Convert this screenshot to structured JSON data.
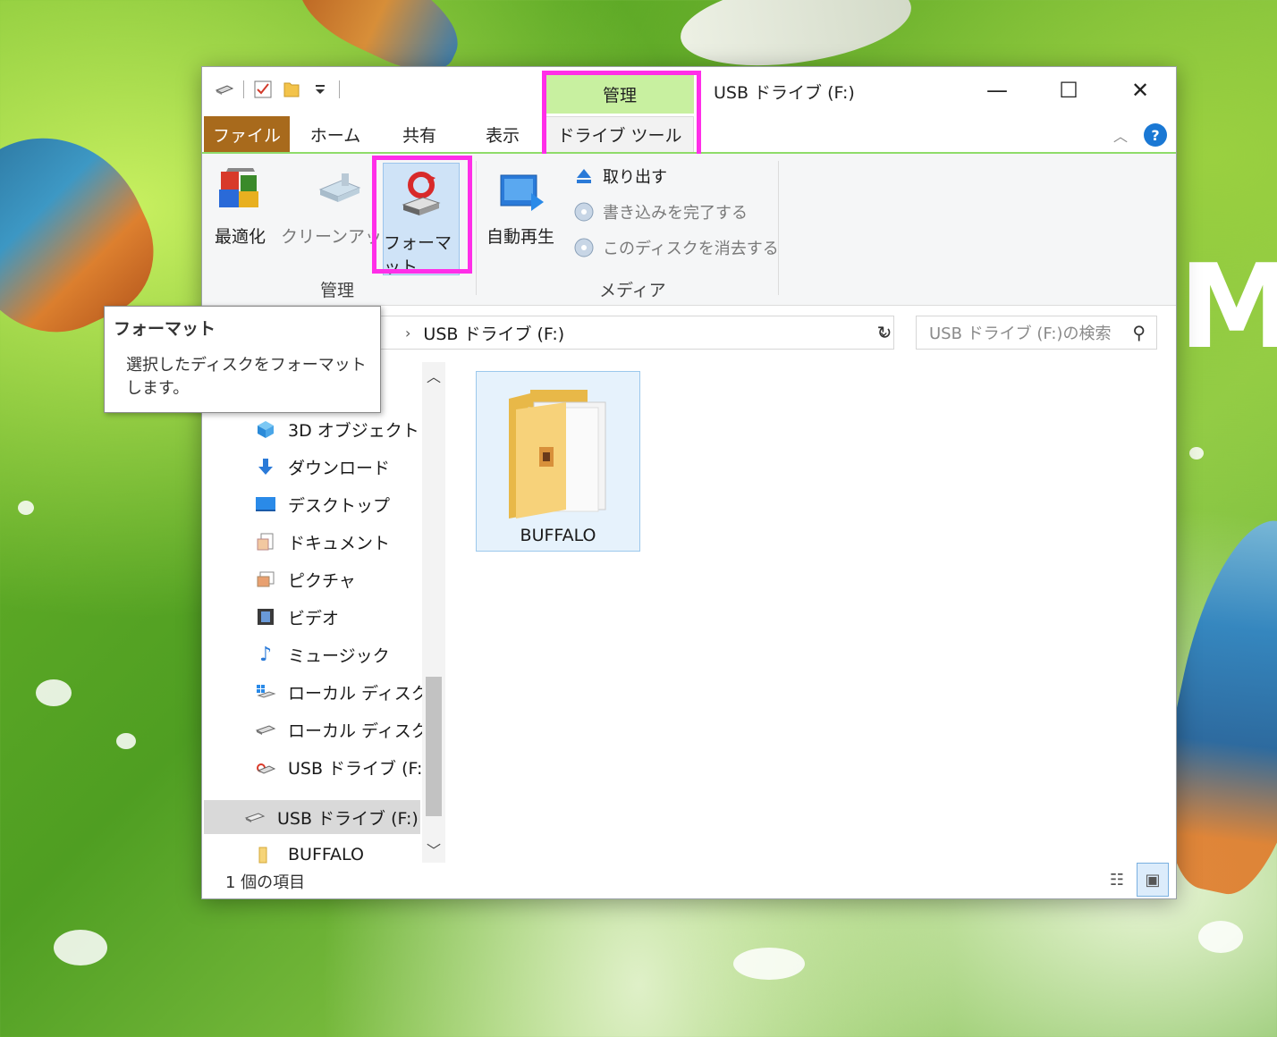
{
  "window": {
    "title": "USB ドライブ (F:)",
    "context_group": "管理",
    "controls": {
      "minimize": "—",
      "maximize": "☐",
      "close": "✕"
    }
  },
  "tabs": [
    {
      "label": "ファイル"
    },
    {
      "label": "ホーム"
    },
    {
      "label": "共有"
    },
    {
      "label": "表示"
    },
    {
      "label": "ドライブ ツール"
    }
  ],
  "ribbon": {
    "manage": {
      "label": "管理",
      "optimize": "最適化",
      "cleanup": "クリーンアップ",
      "format": "フォーマット"
    },
    "media": {
      "label": "メディア",
      "autoplay": "自動再生",
      "eject": "取り出す",
      "finish_burn": "書き込みを完了する",
      "erase_disc": "このディスクを消去する"
    }
  },
  "address": {
    "path": "USB ドライブ (F:)",
    "search_placeholder": "USB ドライブ (F:)の検索"
  },
  "tooltip": {
    "title": "フォーマット",
    "body": "選択したディスクをフォーマットします。"
  },
  "nav": {
    "items": [
      {
        "label": "3D オブジェクト",
        "icon": "cube-icon"
      },
      {
        "label": "ダウンロード",
        "icon": "download-arrow-icon"
      },
      {
        "label": "デスクトップ",
        "icon": "desktop-icon"
      },
      {
        "label": "ドキュメント",
        "icon": "document-icon"
      },
      {
        "label": "ピクチャ",
        "icon": "pictures-icon"
      },
      {
        "label": "ビデオ",
        "icon": "video-icon"
      },
      {
        "label": "ミュージック",
        "icon": "music-note-icon"
      },
      {
        "label": "ローカル ディスク (C",
        "icon": "windows-drive-icon"
      },
      {
        "label": "ローカル ディスク (D",
        "icon": "drive-icon"
      },
      {
        "label": "USB ドライブ (F:)",
        "icon": "usb-drive-icon"
      },
      {
        "label": "USB ドライブ (F:)",
        "icon": "usb-drive-icon",
        "selected": true
      },
      {
        "label": "BUFFALO",
        "icon": "folder-icon"
      }
    ]
  },
  "content": {
    "items": [
      {
        "label": "BUFFALO",
        "icon": "folder-icon"
      }
    ]
  },
  "status": {
    "count": "1 個の項目"
  },
  "colors": {
    "file_tab": "#a86a1c",
    "context_group": "#c8f0a0",
    "highlight": "#ff2ee8",
    "accent": "#1a78d4"
  }
}
